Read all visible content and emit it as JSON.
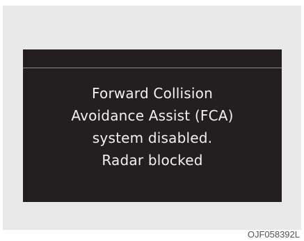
{
  "display": {
    "message_lines": [
      "Forward Collision",
      "Avoidance Assist (FCA)",
      "system disabled.",
      "Radar blocked"
    ]
  },
  "figure": {
    "code": "OJF058392L"
  },
  "colors": {
    "screen_background": "#231f20",
    "text": "#f1f1f1",
    "frame_background": "#e9e9e9"
  }
}
